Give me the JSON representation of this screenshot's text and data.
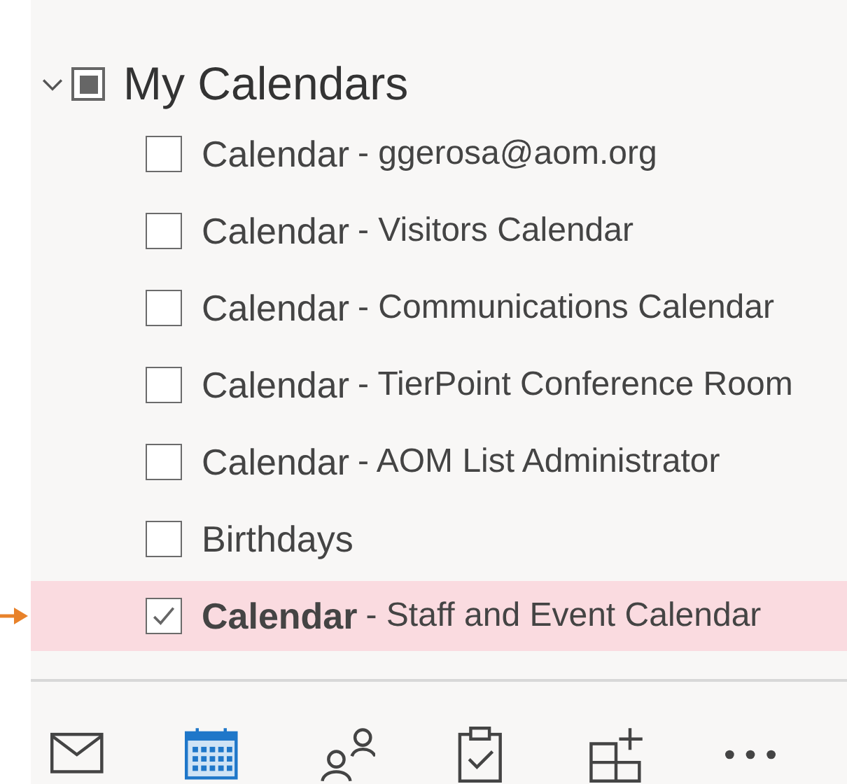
{
  "group": {
    "title": "My Calendars",
    "expanded": true,
    "partial": true,
    "items": [
      {
        "name": "Calendar",
        "detail": "- ggerosa@aom.org",
        "checked": false,
        "selected": false
      },
      {
        "name": "Calendar",
        "detail": "- Visitors Calendar",
        "checked": false,
        "selected": false
      },
      {
        "name": "Calendar",
        "detail": "- Communications Calendar",
        "checked": false,
        "selected": false
      },
      {
        "name": "Calendar",
        "detail": "- TierPoint Conference Room",
        "checked": false,
        "selected": false
      },
      {
        "name": "Calendar",
        "detail": "- AOM List Administrator",
        "checked": false,
        "selected": false
      },
      {
        "name": "Birthdays",
        "checked": false,
        "selected": false
      },
      {
        "name": "Calendar",
        "detail": "- Staff and Event Calendar",
        "checked": true,
        "selected": true
      }
    ]
  },
  "nav": [
    {
      "kind": "mail",
      "selected": false
    },
    {
      "kind": "calendar",
      "selected": true
    },
    {
      "kind": "people",
      "selected": false
    },
    {
      "kind": "tasks",
      "selected": false
    },
    {
      "kind": "apps",
      "selected": false
    },
    {
      "kind": "more",
      "selected": false
    }
  ]
}
